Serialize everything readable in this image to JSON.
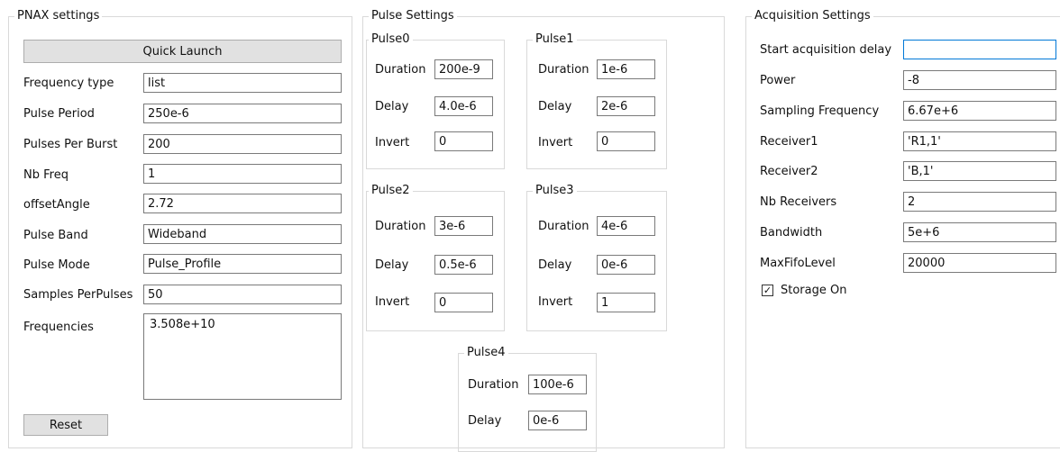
{
  "pnax": {
    "title": "PNAX settings",
    "quick_launch": "Quick Launch",
    "fields": [
      {
        "label": "Frequency type",
        "value": "list"
      },
      {
        "label": "Pulse Period",
        "value": "250e-6"
      },
      {
        "label": "Pulses Per Burst",
        "value": "200"
      },
      {
        "label": "Nb Freq",
        "value": "1"
      },
      {
        "label": "offsetAngle",
        "value": "2.72"
      },
      {
        "label": "Pulse Band",
        "value": "Wideband"
      },
      {
        "label": "Pulse Mode",
        "value": "Pulse_Profile"
      },
      {
        "label": "Samples PerPulses",
        "value": "50"
      }
    ],
    "frequencies_label": "Frequencies",
    "frequencies_value": "3.508e+10",
    "reset": "Reset"
  },
  "pulse": {
    "title": "Pulse Settings",
    "duration_label": "Duration",
    "delay_label": "Delay",
    "invert_label": "Invert",
    "pulses": [
      {
        "name": "Pulse0",
        "duration": "200e-9",
        "delay": "4.0e-6",
        "invert": "0"
      },
      {
        "name": "Pulse1",
        "duration": "1e-6",
        "delay": "2e-6",
        "invert": "0"
      },
      {
        "name": "Pulse2",
        "duration": "3e-6",
        "delay": "0.5e-6",
        "invert": "0"
      },
      {
        "name": "Pulse3",
        "duration": "4e-6",
        "delay": "0e-6",
        "invert": "1"
      },
      {
        "name": "Pulse4",
        "duration": "100e-6",
        "delay": "0e-6"
      }
    ]
  },
  "acq": {
    "title": "Acquisition Settings",
    "fields": [
      {
        "label": "Start acquisition delay",
        "value": ""
      },
      {
        "label": "Power",
        "value": "-8"
      },
      {
        "label": "Sampling Frequency",
        "value": "6.67e+6"
      },
      {
        "label": "Receiver1",
        "value": "'R1,1'"
      },
      {
        "label": "Receiver2",
        "value": "'B,1'"
      },
      {
        "label": "Nb Receivers",
        "value": "2"
      },
      {
        "label": "Bandwidth",
        "value": "5e+6"
      },
      {
        "label": "MaxFifoLevel",
        "value": "20000"
      }
    ],
    "storage_label": "Storage On",
    "storage_checked": true
  }
}
